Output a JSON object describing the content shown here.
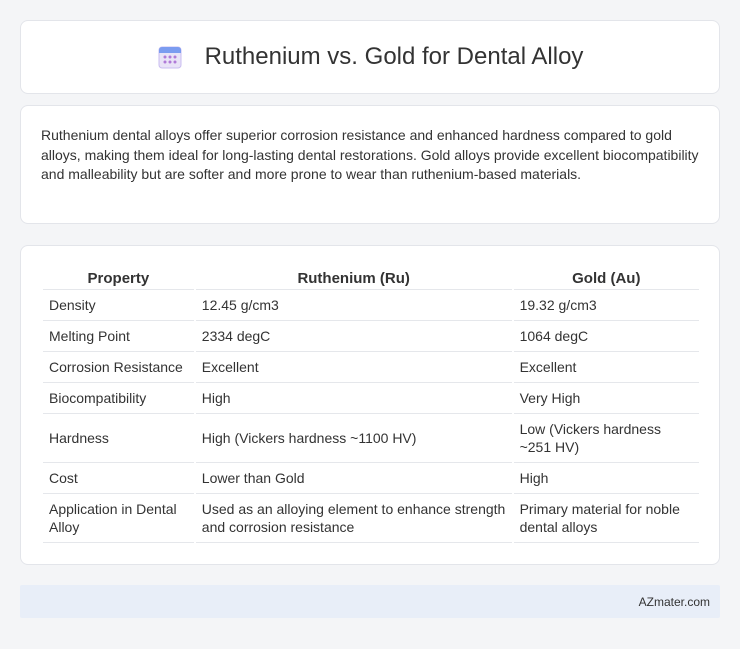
{
  "header": {
    "title": "Ruthenium vs. Gold for Dental Alloy",
    "icon": "calendar-icon"
  },
  "intro": {
    "text": "Ruthenium dental alloys offer superior corrosion resistance and enhanced hardness compared to gold alloys, making them ideal for long-lasting dental restorations. Gold alloys provide excellent biocompatibility and malleability but are softer and more prone to wear than ruthenium-based materials."
  },
  "table": {
    "headers": [
      "Property",
      "Ruthenium (Ru)",
      "Gold (Au)"
    ],
    "rows": [
      [
        "Density",
        "12.45 g/cm3",
        "19.32 g/cm3"
      ],
      [
        "Melting Point",
        "2334 degC",
        "1064 degC"
      ],
      [
        "Corrosion Resistance",
        "Excellent",
        "Excellent"
      ],
      [
        "Biocompatibility",
        "High",
        "Very High"
      ],
      [
        "Hardness",
        "High (Vickers hardness ~1100 HV)",
        "Low (Vickers hardness ~251 HV)"
      ],
      [
        "Cost",
        "Lower than Gold",
        "High"
      ],
      [
        "Application in Dental Alloy",
        "Used as an alloying element to enhance strength and corrosion resistance",
        "Primary material for noble dental alloys"
      ]
    ]
  },
  "footer": {
    "text": "AZmater.com"
  }
}
